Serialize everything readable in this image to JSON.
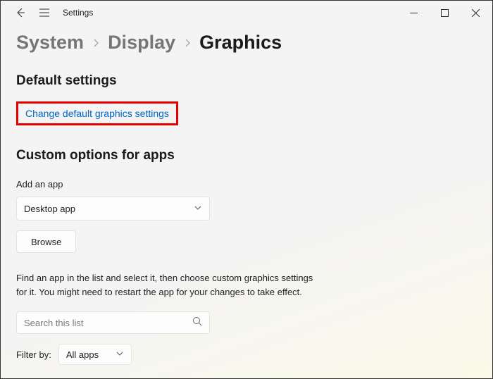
{
  "titlebar": {
    "title": "Settings"
  },
  "breadcrumb": {
    "lvl1": "System",
    "lvl2": "Display",
    "current": "Graphics"
  },
  "default_section": {
    "heading": "Default settings",
    "link": "Change default graphics settings"
  },
  "custom_section": {
    "heading": "Custom options for apps",
    "add_label": "Add an app",
    "app_type_selected": "Desktop app",
    "browse_label": "Browse",
    "instructions": "Find an app in the list and select it, then choose custom graphics settings for it. You might need to restart the app for your changes to take effect.",
    "search_placeholder": "Search this list",
    "filter_label": "Filter by:",
    "filter_selected": "All apps"
  }
}
